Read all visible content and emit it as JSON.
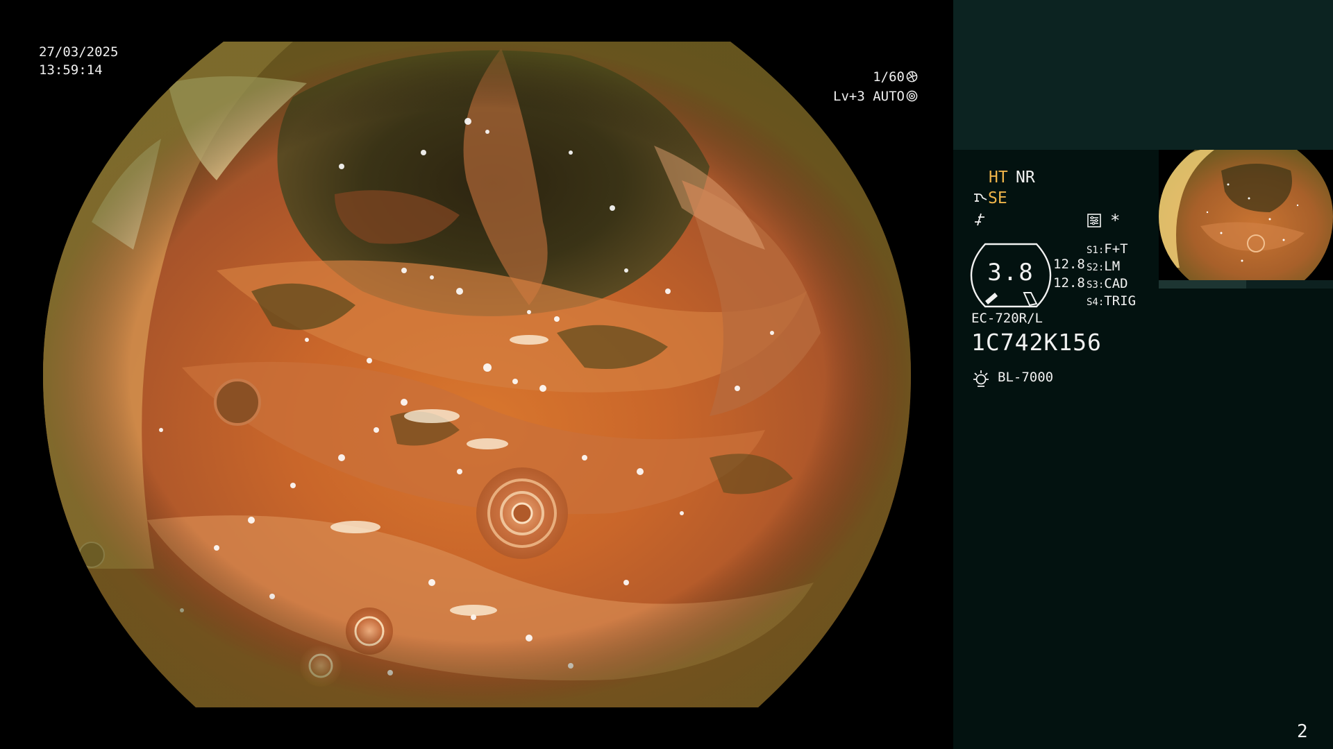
{
  "overlay": {
    "date": "27/03/2025",
    "time": "13:59:14",
    "shutter": "1/60",
    "shutter_icon": "shutter-icon",
    "exposure": "Lv+3 AUTO",
    "exposure_icon": "iris-icon"
  },
  "panel": {
    "ht": "HT",
    "nr": "NR",
    "se": "SE",
    "se_icon": "scope-icon",
    "enhance_icon": "enhance-icon",
    "settings_icon": "settings-icon",
    "asterisk": "*",
    "zoom": {
      "value": "3.8",
      "top_value": "12.8",
      "bottom_value": "12.8"
    },
    "switches": [
      {
        "key": "S1:",
        "value": "F+T"
      },
      {
        "key": "S2:",
        "value": "LM"
      },
      {
        "key": "S3:",
        "value": "CAD"
      },
      {
        "key": "S4:",
        "value": "TRIG"
      }
    ],
    "scope_model": "EC-720R/L",
    "scope_serial": "1C742K156",
    "light_source": "BL-7000",
    "light_icon": "lamp-icon",
    "page_number": "2"
  },
  "colors": {
    "panel_background": "#031210",
    "panel_top_block": "#0c2321",
    "accent_orange": "#f0b54a",
    "text": "#f2f2f2"
  }
}
